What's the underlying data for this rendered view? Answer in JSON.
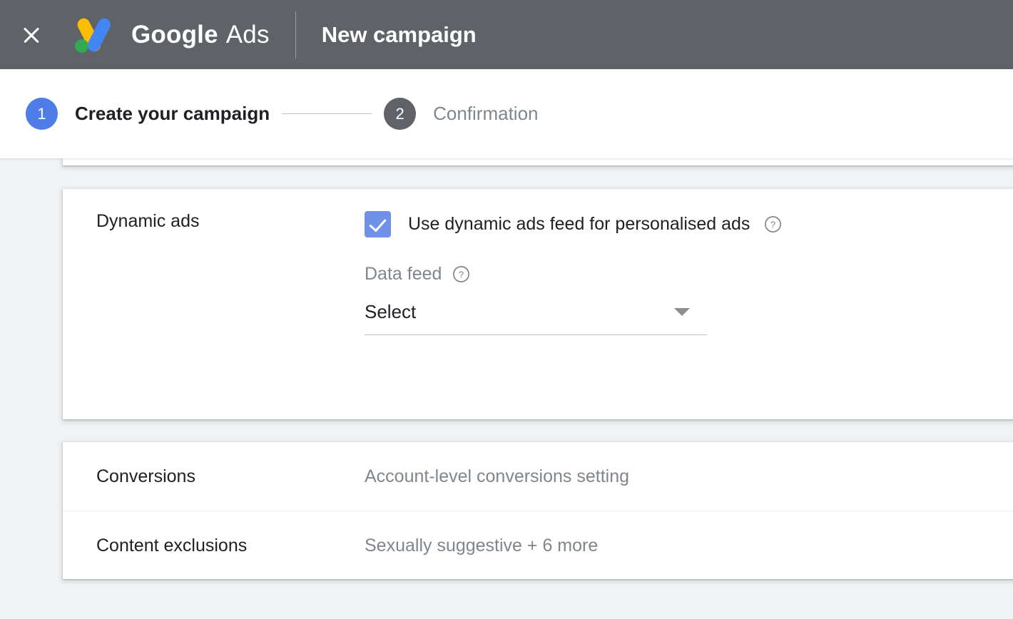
{
  "topbar": {
    "close_label": "close-icon",
    "logo_name": "google-ads-logo",
    "brand_google": "Google",
    "brand_ads": "Ads",
    "page_title": "New campaign"
  },
  "stepper": {
    "steps": [
      {
        "number": "1",
        "label": "Create your campaign",
        "state": "active"
      },
      {
        "number": "2",
        "label": "Confirmation",
        "state": "inactive"
      }
    ]
  },
  "dynamic_ads": {
    "section_label": "Dynamic ads",
    "checkbox": {
      "label": "Use dynamic ads feed for personalised ads",
      "checked": true,
      "help_icon": "help-circle-icon"
    },
    "data_feed": {
      "label": "Data feed",
      "help_icon": "help-circle-icon",
      "select_value": "Select",
      "caret_icon": "chevron-down-icon"
    }
  },
  "settings_rows": [
    {
      "label": "Conversions",
      "value": "Account-level conversions setting"
    },
    {
      "label": "Content exclusions",
      "value": "Sexually suggestive + 6 more"
    }
  ],
  "colors": {
    "header_gray": "#5F6368",
    "accent_blue": "#4E7CE8",
    "checkbox_blue": "#6F91E8",
    "page_background": "#F1F3F4",
    "text_primary": "#202124",
    "text_secondary": "#80868B"
  }
}
